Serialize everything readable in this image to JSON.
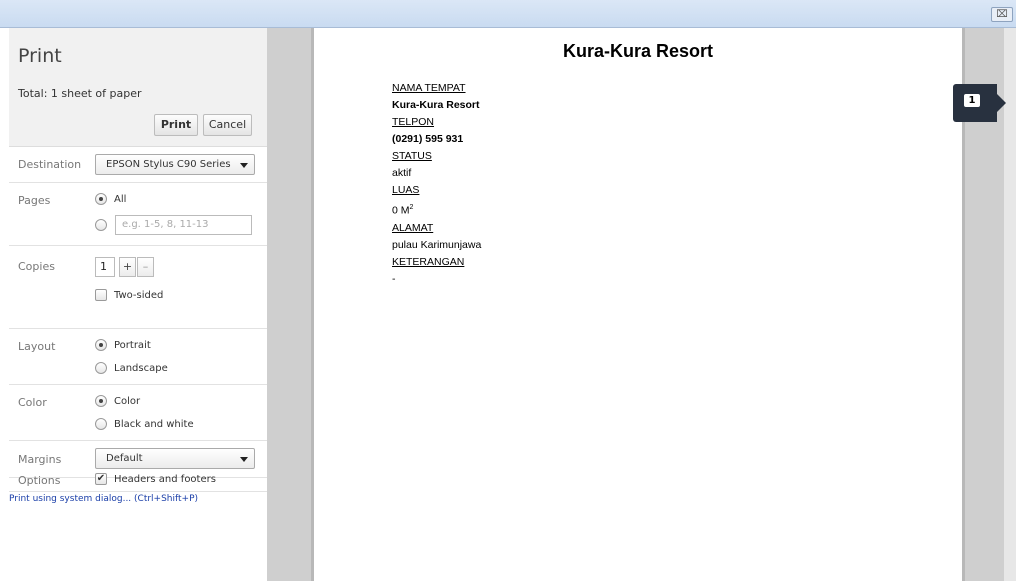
{
  "window": {
    "close_glyph": "⌧"
  },
  "panel": {
    "title": "Print",
    "total": "Total: 1 sheet of paper",
    "print_label": "Print",
    "cancel_label": "Cancel",
    "destination": {
      "label": "Destination",
      "value": "EPSON Stylus C90 Series"
    },
    "pages": {
      "label": "Pages",
      "all": "All",
      "range_placeholder": "e.g. 1-5, 8, 11-13",
      "selected": "All"
    },
    "copies": {
      "label": "Copies",
      "value": "1",
      "plus": "+",
      "minus": "–",
      "two_sided": "Two-sided",
      "two_sided_checked": false
    },
    "layout": {
      "label": "Layout",
      "portrait": "Portrait",
      "landscape": "Landscape",
      "selected": "Portrait"
    },
    "color": {
      "label": "Color",
      "color": "Color",
      "bw": "Black and white",
      "selected": "Color"
    },
    "margins": {
      "label": "Margins",
      "value": "Default"
    },
    "options": {
      "label": "Options",
      "headers_footers": "Headers and footers",
      "headers_footers_checked": true
    },
    "system_dialog": "Print using system dialog... (Ctrl+Shift+P)"
  },
  "preview": {
    "page_number": "1",
    "title": "Kura-Kura Resort",
    "fields": {
      "nama_label": "NAMA TEMPAT",
      "nama_value": "Kura-Kura Resort",
      "telpon_label": "TELPON",
      "telpon_value": "(0291) 595 931",
      "status_label": "STATUS",
      "status_value": "aktif",
      "luas_label": "LUAS",
      "luas_value": "0 M",
      "luas_sup": "2",
      "alamat_label": "ALAMAT",
      "alamat_value": "pulau Karimunjawa",
      "keterangan_label": "KETERANGAN",
      "keterangan_value": "-"
    }
  },
  "colors": {
    "link": "#1a3ea8",
    "badge": "#28313f",
    "panel_header": "#f1f1f1",
    "preview_bg": "#cfcfcf"
  }
}
